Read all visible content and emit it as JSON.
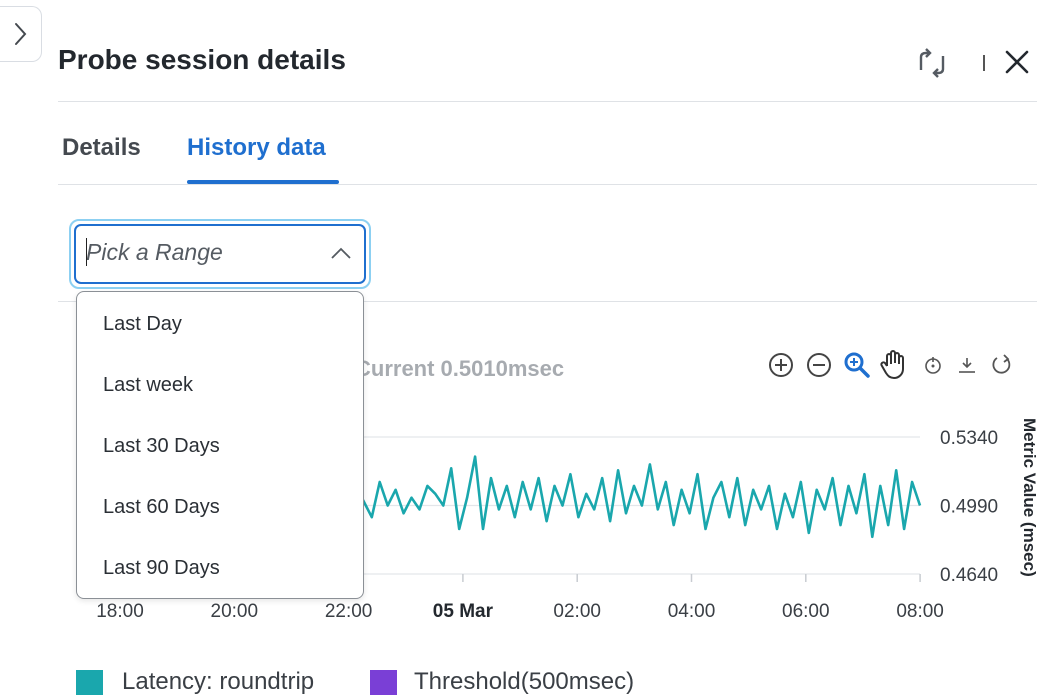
{
  "panel": {
    "title": "Probe session details"
  },
  "tabs": [
    {
      "label": "Details",
      "active": false
    },
    {
      "label": "History data",
      "active": true
    }
  ],
  "range_picker": {
    "placeholder": "Pick a Range",
    "value": "",
    "options": [
      "Last Day",
      "Last week",
      "Last 30 Days",
      "Last 60 Days",
      "Last 90 Days"
    ]
  },
  "chart_header": {
    "current_text": "Current 0.5010msec"
  },
  "toolbar": {
    "icons": [
      "zoom-in-icon",
      "zoom-out-icon",
      "zoom-select-icon",
      "pan-hand-icon",
      "reset-icon",
      "download-icon",
      "refresh-icon"
    ]
  },
  "colors": {
    "accent": "#1f6fcf",
    "focus_ring": "#8cd0f2",
    "latency": "#1aa7ad",
    "threshold": "#7a3fd6"
  },
  "chart_data": {
    "type": "line",
    "x": [
      "18:00",
      "18:20",
      "18:40",
      "19:00",
      "19:20",
      "19:40",
      "20:00",
      "20:20",
      "20:40",
      "21:00",
      "21:20",
      "21:40",
      "22:00",
      "22:10",
      "22:20",
      "22:30",
      "22:40",
      "22:50",
      "23:00",
      "23:10",
      "23:20",
      "23:30",
      "23:40",
      "23:50",
      "00:00",
      "00:10",
      "00:20",
      "00:30",
      "00:40",
      "00:50",
      "01:00",
      "01:10",
      "01:20",
      "01:30",
      "01:40",
      "01:50",
      "02:00",
      "02:10",
      "02:20",
      "02:30",
      "02:40",
      "02:50",
      "03:00",
      "03:10",
      "03:20",
      "03:30",
      "03:40",
      "03:50",
      "04:00",
      "04:10",
      "04:20",
      "04:30",
      "04:40",
      "04:50",
      "05:00",
      "05:10",
      "05:20",
      "05:30",
      "05:40",
      "05:50",
      "06:00",
      "06:10",
      "06:20",
      "06:30",
      "06:40",
      "06:50",
      "07:00",
      "07:10",
      "07:20",
      "07:30",
      "07:40",
      "07:50",
      "08:00",
      "08:05"
    ],
    "series": [
      {
        "name": "Latency: roundtrip",
        "values": [
          0.505,
          0.497,
          0.509,
          0.501,
          0.493,
          0.511,
          0.499,
          0.507,
          0.495,
          0.503,
          0.497,
          0.509,
          0.505,
          0.499,
          0.518,
          0.487,
          0.503,
          0.524,
          0.487,
          0.513,
          0.497,
          0.509,
          0.493,
          0.511,
          0.497,
          0.513,
          0.491,
          0.509,
          0.499,
          0.515,
          0.493,
          0.505,
          0.497,
          0.513,
          0.491,
          0.517,
          0.495,
          0.509,
          0.499,
          0.52,
          0.497,
          0.511,
          0.489,
          0.507,
          0.495,
          0.515,
          0.487,
          0.503,
          0.511,
          0.493,
          0.513,
          0.489,
          0.507,
          0.497,
          0.509,
          0.487,
          0.505,
          0.493,
          0.511,
          0.485,
          0.507,
          0.497,
          0.513,
          0.489,
          0.509,
          0.495,
          0.515,
          0.483,
          0.509,
          0.489,
          0.517,
          0.487,
          0.511,
          0.499
        ]
      },
      {
        "name": "Threshold(500msec)",
        "values": []
      }
    ],
    "x_ticks": [
      "18:00",
      "20:00",
      "22:00",
      "05 Mar",
      "02:00",
      "04:00",
      "06:00",
      "08:00"
    ],
    "y_ticks": [
      "0.5340",
      "0.4990",
      "0.4640"
    ],
    "ylabel": "Metric Value (msec)",
    "ylim": [
      0.464,
      0.534
    ],
    "grid": true,
    "legend": "bottom-left"
  }
}
